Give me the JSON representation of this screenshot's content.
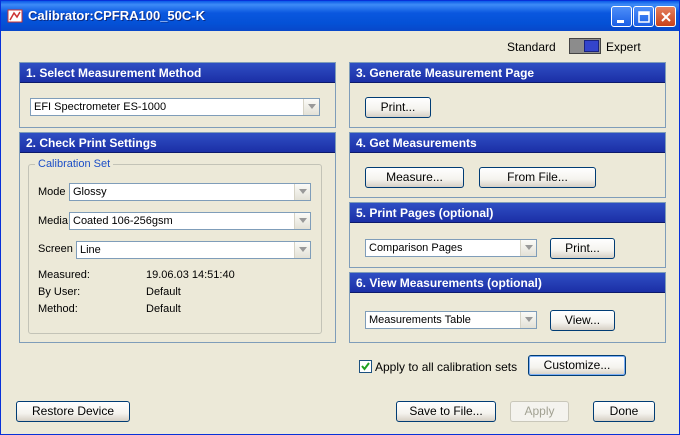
{
  "window": {
    "title": "Calibrator:CPFRA100_50C-K"
  },
  "mode": {
    "standard": "Standard",
    "expert": "Expert"
  },
  "section1": {
    "title": "1. Select Measurement Method",
    "method": "EFI Spectrometer ES-1000"
  },
  "section2": {
    "title": "2. Check Print Settings",
    "group_title": "Calibration Set",
    "mode_label": "Mode",
    "mode_value": "Glossy",
    "media_label": "Media",
    "media_value": "Coated 106-256gsm",
    "screen_label": "Screen",
    "screen_value": "Line",
    "measured_label": "Measured:",
    "measured_value": "19.06.03 14:51:40",
    "by_user_label": "By User:",
    "by_user_value": "Default",
    "method_label": "Method:",
    "method_value": "Default"
  },
  "section3": {
    "title": "3. Generate Measurement Page",
    "print": "Print..."
  },
  "section4": {
    "title": "4. Get Measurements",
    "measure": "Measure...",
    "from_file": "From File..."
  },
  "section5": {
    "title": "5. Print Pages (optional)",
    "pages": "Comparison Pages",
    "print": "Print..."
  },
  "section6": {
    "title": "6. View Measurements (optional)",
    "view_type": "Measurements Table",
    "view": "View..."
  },
  "apply_all": {
    "label": "Apply to all calibration sets",
    "checked": true
  },
  "buttons": {
    "customize": "Customize...",
    "restore": "Restore Device",
    "save": "Save to File...",
    "apply": "Apply",
    "done": "Done"
  },
  "colors": {
    "title_bar": "#0a57df",
    "panel_header": "#1b2fa6",
    "background": "#ece9d8",
    "toggle_knob": "#3344cc"
  },
  "icons": [
    "calibrator-app-icon",
    "minimize-icon",
    "maximize-icon",
    "close-icon",
    "dropdown-arrow-icon",
    "checkmark-icon"
  ]
}
